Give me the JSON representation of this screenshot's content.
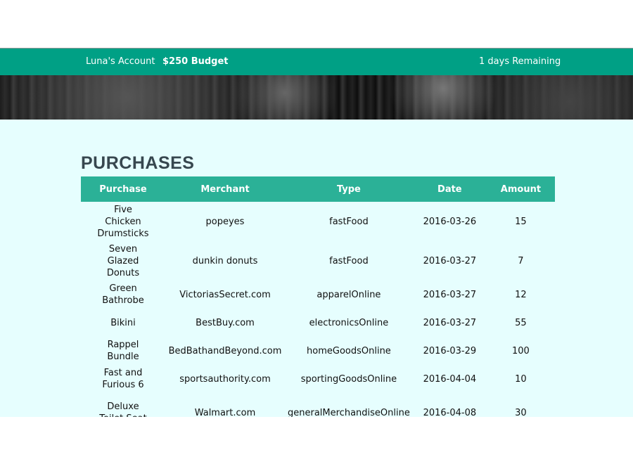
{
  "header": {
    "account": "Luna's Account",
    "budget": "$250 Budget",
    "remaining": "1 days Remaining"
  },
  "title": "PURCHASES",
  "columns": [
    "Purchase",
    "Merchant",
    "Type",
    "Date",
    "Amount"
  ],
  "rows": [
    [
      "Five Chicken Drumsticks",
      "popeyes",
      "fastFood",
      "2016-03-26",
      "15"
    ],
    [
      "Seven Glazed Donuts",
      "dunkin donuts",
      "fastFood",
      "2016-03-27",
      "7"
    ],
    [
      "Green Bathrobe",
      "VictoriasSecret.com",
      "apparelOnline",
      "2016-03-27",
      "12"
    ],
    [
      "Bikini",
      "BestBuy.com",
      "electronicsOnline",
      "2016-03-27",
      "55"
    ],
    [
      "Rappel Bundle",
      "BedBathandBeyond.com",
      "homeGoodsOnline",
      "2016-03-29",
      "100"
    ],
    [
      "Fast and Furious 6",
      "sportsauthority.com",
      "sportingGoodsOnline",
      "2016-04-04",
      "10"
    ],
    [
      "Deluxe Toilet Seat",
      "Walmart.com",
      "generalMerchandiseOnline",
      "2016-04-08",
      "30"
    ]
  ]
}
